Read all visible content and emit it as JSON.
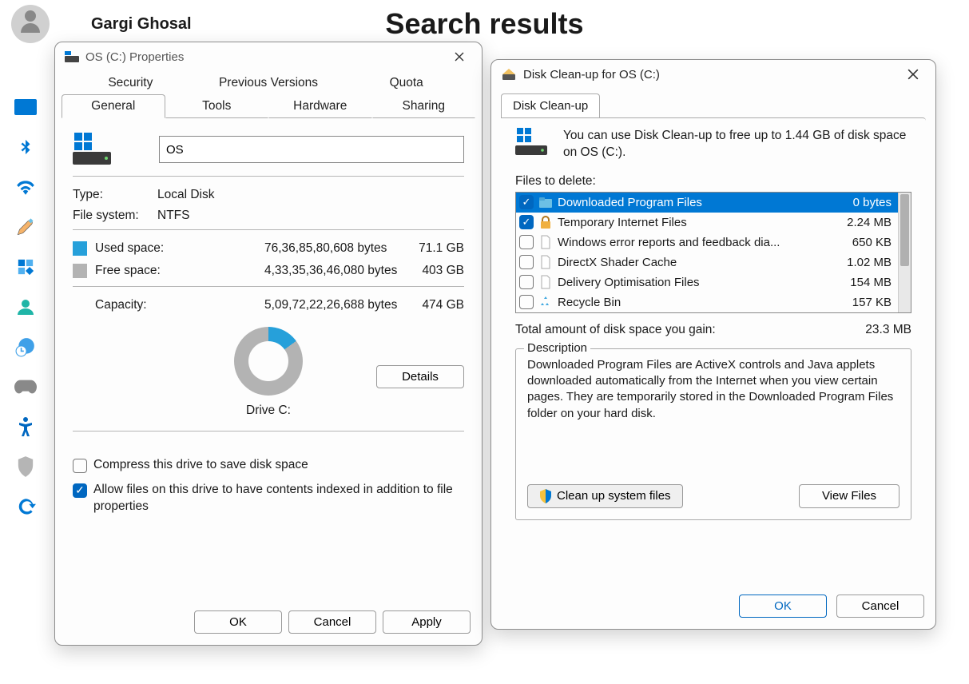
{
  "header": {
    "username": "Gargi Ghosal",
    "page_title": "Search results"
  },
  "rail": [
    "system",
    "bluetooth",
    "wifi",
    "paint",
    "apps-small",
    "account",
    "globe-clock",
    "game",
    "accessibility",
    "shield",
    "sync"
  ],
  "props": {
    "title": "OS (C:) Properties",
    "tabs_top": [
      "Security",
      "Previous Versions",
      "Quota"
    ],
    "tabs_bottom": [
      "General",
      "Tools",
      "Hardware",
      "Sharing"
    ],
    "active_tab": "General",
    "drive_name": "OS",
    "type_label": "Type:",
    "type_value": "Local Disk",
    "fs_label": "File system:",
    "fs_value": "NTFS",
    "used_label": "Used space:",
    "used_bytes": "76,36,85,80,608 bytes",
    "used_gb": "71.1 GB",
    "free_label": "Free space:",
    "free_bytes": "4,33,35,36,46,080 bytes",
    "free_gb": "403 GB",
    "capacity_label": "Capacity:",
    "capacity_bytes": "5,09,72,22,26,688 bytes",
    "capacity_gb": "474 GB",
    "drive_caption": "Drive C:",
    "details_btn": "Details",
    "compress_label": "Compress this drive to save disk space",
    "index_label": "Allow files on this drive to have contents indexed in addition to file properties",
    "ok": "OK",
    "cancel": "Cancel",
    "apply": "Apply"
  },
  "cleanup": {
    "title": "Disk Clean-up for OS (C:)",
    "tab": "Disk Clean-up",
    "headline": "You can use Disk Clean-up to free up to 1.44 GB of disk space on OS (C:).",
    "files_to_delete_label": "Files to delete:",
    "items": [
      {
        "name": "Downloaded Program Files",
        "size": "0 bytes",
        "checked": true,
        "selected": true,
        "icon": "folder-blue"
      },
      {
        "name": "Temporary Internet Files",
        "size": "2.24 MB",
        "checked": true,
        "selected": false,
        "icon": "lock"
      },
      {
        "name": "Windows error reports and feedback dia...",
        "size": "650 KB",
        "checked": false,
        "selected": false,
        "icon": "file"
      },
      {
        "name": "DirectX Shader Cache",
        "size": "1.02 MB",
        "checked": false,
        "selected": false,
        "icon": "file"
      },
      {
        "name": "Delivery Optimisation Files",
        "size": "154 MB",
        "checked": false,
        "selected": false,
        "icon": "file"
      },
      {
        "name": "Recycle Bin",
        "size": "157 KB",
        "checked": false,
        "selected": false,
        "icon": "recycle"
      }
    ],
    "total_label": "Total amount of disk space you gain:",
    "total_value": "23.3 MB",
    "desc_legend": "Description",
    "desc_text": "Downloaded Program Files are ActiveX controls and Java applets downloaded automatically from the Internet when you view certain pages. They are temporarily stored in the Downloaded Program Files folder on your hard disk.",
    "system_btn": "Clean up system files",
    "view_btn": "View Files",
    "ok": "OK",
    "cancel": "Cancel"
  }
}
